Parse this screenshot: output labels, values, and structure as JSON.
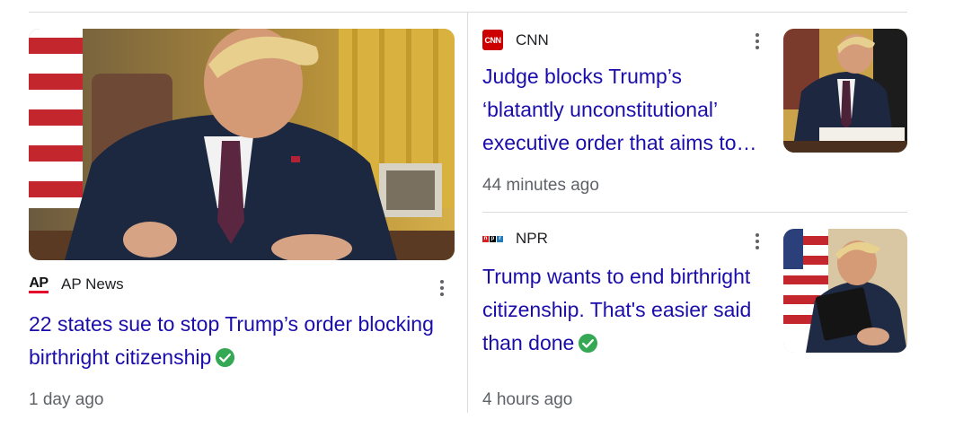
{
  "stories": [
    {
      "source": "AP News",
      "headline": "22 states sue to stop Trump’s order blocking birthright citizenship",
      "headline_lines": [
        "22 states sue to stop Trump’s order blocking",
        "birthright citizenship"
      ],
      "time": "1 day ago",
      "verified": true
    },
    {
      "source": "CNN",
      "logo_text": "CNN",
      "headline_lines": [
        "Judge blocks Trump’s",
        "‘blatantly unconstitutional’",
        "executive order that aims to…"
      ],
      "time": "44 minutes ago",
      "verified": false
    },
    {
      "source": "NPR",
      "logo_letters": [
        "n",
        "p",
        "r"
      ],
      "headline_lines": [
        "Trump wants to end birthright",
        "citizenship. That's easier said",
        "than done"
      ],
      "time": "4 hours ago",
      "verified": true
    }
  ],
  "colors": {
    "headline": "#1a0dab",
    "meta": "#5f6368",
    "verified": "#34a853",
    "cnn": "#cc0000",
    "npr_n": "#d62021",
    "npr_p": "#000000",
    "npr_r": "#237bbd"
  },
  "icons": [
    "more-vert-icon",
    "verified-check-icon"
  ]
}
